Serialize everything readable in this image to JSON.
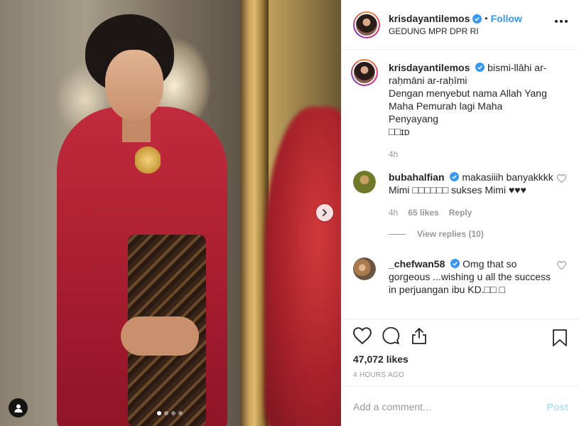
{
  "post": {
    "username": "krisdayantilemos",
    "follow_label": "Follow",
    "separator": "•",
    "location": "GEDUNG MPR DPR RI"
  },
  "caption": {
    "username": "krisdayantilemos",
    "text_line1": "bismi-llāhi ar-raḥmāni ar-raḥīmi",
    "text_line2": "Dengan menyebut nama Allah Yang Maha Pemurah lagi Maha Penyayang",
    "text_line3": "□□ɪᴅ",
    "time": "4h"
  },
  "comments": [
    {
      "username": "bubahalfian",
      "text": "makasiiih banyakkkk Mimi □□□□□□ sukses Mimi ♥♥♥",
      "time": "4h",
      "likes": "65 likes",
      "reply_label": "Reply",
      "view_replies": "View replies (10)"
    },
    {
      "username": "_chefwan58",
      "text": "Omg that so gorgeous ...wishing u all the success in perjuangan ibu KD.□□ □"
    }
  ],
  "stats": {
    "likes": "47,072 likes",
    "time_ago": "4 HOURS AGO"
  },
  "add_comment": {
    "placeholder": "Add a comment...",
    "post_label": "Post"
  },
  "carousel": {
    "total": 4,
    "active_index": 0
  },
  "colors": {
    "link": "#3897f0",
    "verified": "#3897f0",
    "post_disabled": "#b2dffc"
  },
  "icons": [
    "chevron-right-icon",
    "user-tag-icon",
    "heart-icon",
    "comment-icon",
    "share-icon",
    "bookmark-icon",
    "verified-icon",
    "more-icon"
  ]
}
